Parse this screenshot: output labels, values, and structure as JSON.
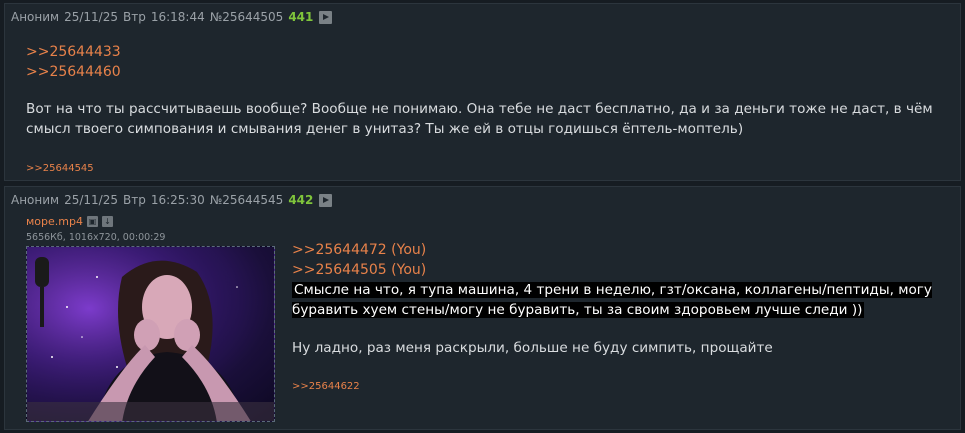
{
  "posts": [
    {
      "author": "Аноним",
      "date": "25/11/25",
      "day": "Втр",
      "time": "16:18:44",
      "id": "№25644505",
      "number": "441",
      "replies_to": [
        ">>25644433",
        ">>25644460"
      ],
      "text": "Вот на что ты рассчитываешь вообще? Вообще не понимаю. Она тебе не даст бесплатно, да и за деньги тоже не даст, в чём смысл твоего симпования и смывания денег в унитаз? Ты же ей в отцы годишься ёптель-моптель)",
      "backlinks": [
        ">>25644545"
      ]
    },
    {
      "author": "Аноним",
      "date": "25/11/25",
      "day": "Втр",
      "time": "16:25:30",
      "id": "№25644545",
      "number": "442",
      "file": {
        "name": "море.mp4",
        "info": "5656Кб, 1016x720, 00:00:29"
      },
      "replies_to": [
        ">>25644472 (You)",
        ">>25644505 (You)"
      ],
      "highlighted_text": "Смысле на что, я тупа машина, 4 трени в неделю, гзт/оксана, коллагены/пептиды, могу буравить хуем стены/могу не буравить, ты за своим здоровьем лучше следи ))",
      "text": "Ну ладно, раз меня раскрыли, больше не буду симпить, прощайте",
      "backlinks": [
        ">>25644622"
      ]
    }
  ],
  "colors": {
    "background": "#161c22",
    "post_bg": "#1e262d",
    "link": "#e8824a",
    "post_number": "#7fc43b"
  }
}
